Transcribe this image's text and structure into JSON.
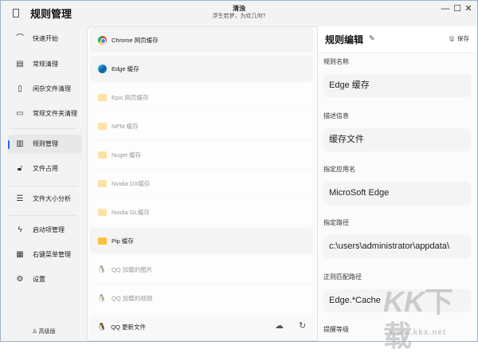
{
  "titlebar": {
    "app_title": "规则管理",
    "center_title": "清浊",
    "center_subtitle": "浮生若梦，为欢几何?",
    "minimize": "—",
    "maximize": "☐",
    "close": "✕"
  },
  "sidebar": {
    "items": [
      {
        "label": "快速开始",
        "icon": "gauge-icon",
        "glyph": "⌒"
      },
      {
        "label": "常规清理",
        "icon": "cleanup-icon",
        "glyph": "▤"
      },
      {
        "label": "闲杂文件清理",
        "icon": "file-chart-icon",
        "glyph": "▯"
      },
      {
        "label": "常规文件夹清理",
        "icon": "folder-icon",
        "glyph": "▭"
      },
      {
        "label": "规则管理",
        "icon": "rules-icon",
        "glyph": "▥"
      },
      {
        "label": "文件占用",
        "icon": "unlock-icon",
        "glyph": "🔓︎"
      },
      {
        "label": "文件大小分析",
        "icon": "list-icon",
        "glyph": "☰"
      },
      {
        "label": "启动项管理",
        "icon": "bolt-icon",
        "glyph": "ϟ"
      },
      {
        "label": "右键菜单管理",
        "icon": "menu-grid-icon",
        "glyph": "▦"
      },
      {
        "label": "设置",
        "icon": "gear-icon",
        "glyph": "⚙"
      }
    ],
    "pro_label": "高级版",
    "pro_glyph": "♙"
  },
  "rules": {
    "items": [
      {
        "label": "Chrome 网页缓存",
        "icon": "chrome",
        "enabled": true
      },
      {
        "label": "Edge 缓存",
        "icon": "edge",
        "enabled": true,
        "selected": true
      },
      {
        "label": "Epic 网页缓存",
        "icon": "folder",
        "enabled": false
      },
      {
        "label": "NPM 缓存",
        "icon": "folder",
        "enabled": false
      },
      {
        "label": "Nuget 缓存",
        "icon": "folder",
        "enabled": false
      },
      {
        "label": "Nvidia DX缓存",
        "icon": "folder",
        "enabled": false
      },
      {
        "label": "Nvidia GL缓存",
        "icon": "folder",
        "enabled": false
      },
      {
        "label": "Pip 缓存",
        "icon": "folder",
        "enabled": true
      },
      {
        "label": "QQ 加载的图片",
        "icon": "qq",
        "enabled": false
      },
      {
        "label": "QQ 加载的视频",
        "icon": "qq",
        "enabled": false
      }
    ],
    "bottom_item": {
      "label": "QQ 更新文件",
      "cloud": "☁",
      "refresh": "↻"
    },
    "qq_glyph": "🐧"
  },
  "editor": {
    "title": "规则编辑",
    "save_label": "保存",
    "save_glyph": "🖫",
    "edit_glyph": "✎",
    "fields": [
      {
        "label": "规则名称",
        "value": "Edge 缓存"
      },
      {
        "label": "描述信息",
        "value": "缓存文件"
      },
      {
        "label": "指定应用名",
        "value": "MicroSoft Edge"
      },
      {
        "label": "指定路径",
        "value": "c:\\users\\administrator\\appdata\\"
      },
      {
        "label": "正则匹配路径",
        "value": "Edge.*Cache"
      }
    ],
    "next_label": "提醒等级"
  },
  "watermark": {
    "logo": "KK下载",
    "url": "www.kkx.net"
  },
  "colors": {
    "accent": "#1c6ee8",
    "folder": "#fbc13a"
  }
}
